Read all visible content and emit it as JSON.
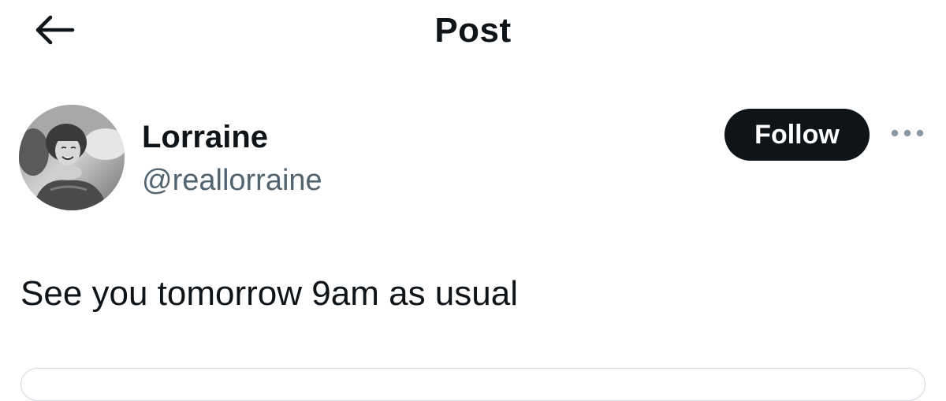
{
  "header": {
    "title": "Post",
    "back_icon": "arrow-left-icon"
  },
  "author": {
    "display_name": "Lorraine",
    "handle": "@reallorraine",
    "avatar": "profile-photo",
    "follow_label": "Follow",
    "more_icon": "more-horizontal-icon"
  },
  "post": {
    "text": "See you tomorrow 9am as usual"
  },
  "colors": {
    "text_primary": "#0f1419",
    "text_secondary": "#536471",
    "button_bg": "#0f1419",
    "button_text": "#ffffff",
    "more_icon": "#8b98a5",
    "border": "#cfd9de"
  }
}
